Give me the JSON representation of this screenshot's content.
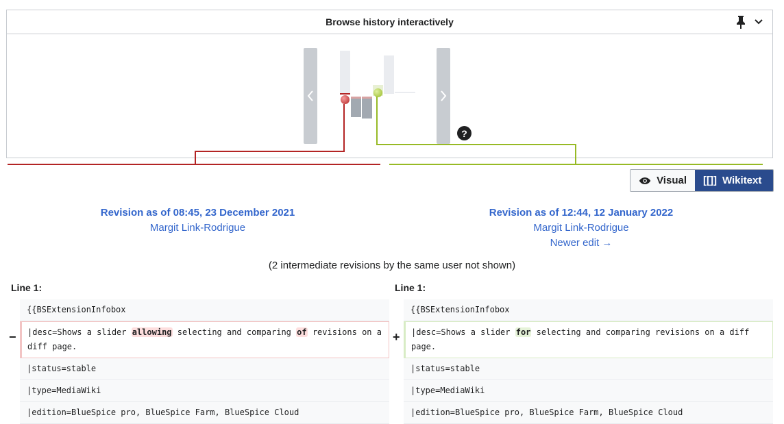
{
  "slider": {
    "title": "Browse history interactively",
    "help_label": "?"
  },
  "mode_toggle": {
    "visual_label": "Visual",
    "wikitext_label": "Wikitext",
    "wikitext_icon": "[[]]",
    "active": "wikitext"
  },
  "left_revision": {
    "title": "Revision as of 08:45, 23 December 2021",
    "user": "Margit Link-Rodrigue"
  },
  "right_revision": {
    "title": "Revision as of 12:44, 12 January 2022",
    "user": "Margit Link-Rodrigue",
    "newer_edit": "Newer edit →"
  },
  "intermediate_note": "(2 intermediate revisions by the same user not shown)",
  "diff": {
    "left_line_label": "Line 1:",
    "right_line_label": "Line 1:",
    "minus_marker": "−",
    "plus_marker": "+",
    "left_rows": {
      "r0": "{{BSExtensionInfobox",
      "r1_a": "|desc=Shows a slider ",
      "r1_del1": "allowing",
      "r1_b": " selecting and comparing ",
      "r1_del2": "of",
      "r1_c": " revisions on a diff page.",
      "r2": "|status=stable",
      "r3": "|type=MediaWiki",
      "r4": "|edition=BlueSpice pro, BlueSpice Farm, BlueSpice Cloud"
    },
    "right_rows": {
      "r0": "{{BSExtensionInfobox",
      "r1_a": "|desc=Shows a slider ",
      "r1_add1": "for",
      "r1_b": " selecting and comparing revisions on a diff page.",
      "r2": "|status=stable",
      "r3": "|type=MediaWiki",
      "r4": "|edition=BlueSpice pro, BlueSpice Farm, BlueSpice Cloud"
    }
  },
  "colors": {
    "older_revision": "#b32424",
    "newer_revision": "#97ba25",
    "link": "#3366cc",
    "active_toggle": "#2a4b8d"
  }
}
